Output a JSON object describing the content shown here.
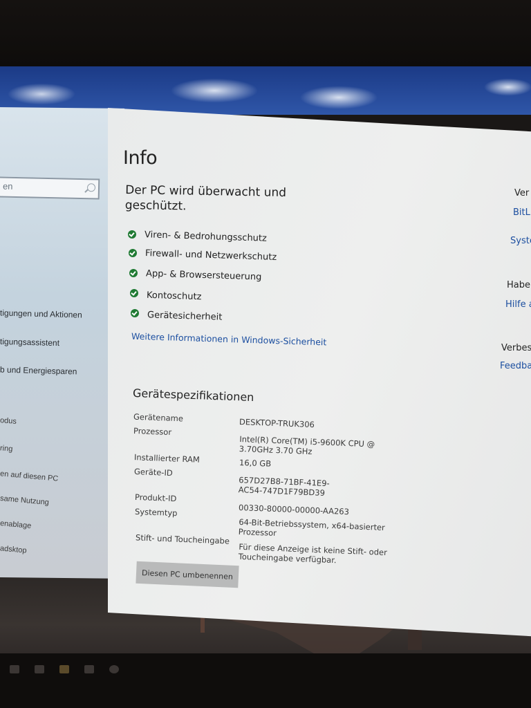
{
  "page": {
    "title": "Info"
  },
  "search": {
    "value": "en"
  },
  "nav": {
    "items": [
      {
        "label": "tigungen und Aktionen"
      },
      {
        "label": "tigungsassistent"
      },
      {
        "label": "b und Energiesparen"
      },
      {
        "label": "odus"
      },
      {
        "label": "ring"
      },
      {
        "label": "en auf diesen PC"
      },
      {
        "label": "same Nutzung"
      },
      {
        "label": "enablage"
      },
      {
        "label": "adsktop"
      }
    ]
  },
  "protection": {
    "headline_line1": "Der PC wird überwacht und",
    "headline_line2": "geschützt.",
    "items": [
      {
        "label": "Viren- & Bedrohungsschutz",
        "icon": "check-circle-icon"
      },
      {
        "label": "Firewall- und Netzwerkschutz",
        "icon": "check-circle-icon"
      },
      {
        "label": "App- & Browsersteuerung",
        "icon": "check-circle-icon"
      },
      {
        "label": "Kontoschutz",
        "icon": "check-circle-icon"
      },
      {
        "label": "Gerätesicherheit",
        "icon": "check-circle-icon"
      }
    ],
    "more_link": "Weitere Informationen in Windows-Sicherheit"
  },
  "specs": {
    "heading": "Gerätespezifikationen",
    "rows": [
      {
        "key": "Gerätename",
        "value": "DESKTOP-TRUK306"
      },
      {
        "key": "Prozessor",
        "value": "Intel(R) Core(TM) i5-9600K CPU @ 3.70GHz   3.70 GHz"
      },
      {
        "key": "Installierter RAM",
        "value": "16,0 GB"
      },
      {
        "key": "Geräte-ID",
        "value": "657D27B8-71BF-41E9-AC54-747D1F79BD39"
      },
      {
        "key": "Produkt-ID",
        "value": "00330-80000-00000-AA263"
      },
      {
        "key": "Systemtyp",
        "value": "64-Bit-Betriebssystem, x64-basierter Prozessor"
      },
      {
        "key": "Stift- und Toucheingabe",
        "value": "Für diese Anzeige ist keine Stift- oder Toucheingabe verfügbar."
      }
    ],
    "rename_button": "Diesen PC umbenennen"
  },
  "related": {
    "items": [
      {
        "text": "Ver",
        "type": "text"
      },
      {
        "text": "BitL",
        "type": "link"
      },
      {
        "text": "Syste",
        "type": "link"
      },
      {
        "text": "Habe",
        "type": "text"
      },
      {
        "text": "Hilfe a",
        "type": "link"
      },
      {
        "text": "Verbes",
        "type": "text"
      },
      {
        "text": "Feedba",
        "type": "link"
      }
    ]
  },
  "colors": {
    "accent_link": "#1c4fa0",
    "check_green": "#1f7a33"
  }
}
